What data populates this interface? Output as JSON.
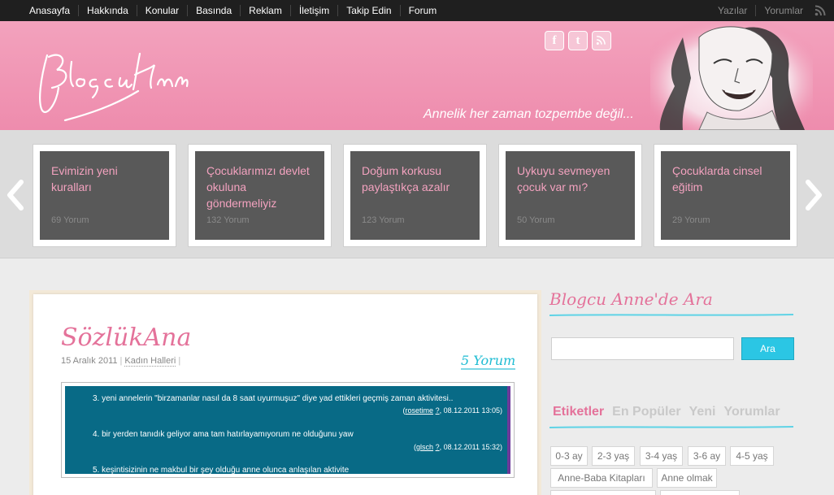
{
  "topnav": {
    "left": [
      "Anasayfa",
      "Hakkında",
      "Konular",
      "Basında",
      "Reklam",
      "İletişim",
      "Takip Edin",
      "Forum"
    ],
    "right": [
      "Yazılar",
      "Yorumlar"
    ]
  },
  "header": {
    "tagline": "Annelik her zaman tozpembe değil...",
    "social": {
      "facebook": "f",
      "twitter": "t"
    }
  },
  "slider": {
    "cards": [
      {
        "title": "Evimizin yeni kuralları",
        "count": "69 Yorum"
      },
      {
        "title": "Çocuklarımızı devlet okuluna göndermeliyiz",
        "count": "132 Yorum"
      },
      {
        "title": "Doğum korkusu paylaştıkça azalır",
        "count": "123 Yorum"
      },
      {
        "title": "Uykuyu sevmeyen çocuk var mı?",
        "count": "50 Yorum"
      },
      {
        "title": "Çocuklarda cinsel eğitim",
        "count": "29 Yorum"
      }
    ]
  },
  "post": {
    "title": "SözlükAna",
    "date": "15 Aralık 2011",
    "category": "Kadın Halleri",
    "comments": "5 Yorum",
    "entries": [
      {
        "text": "3.  yeni annelerin \"birzamanlar nasıl da 8 saat uyurmuşuz\" diye yad ettikleri geçmiş zaman aktivitesi..",
        "user": "rosetime",
        "q": "?",
        "date": ", 08.12.2011 13:05)"
      },
      {
        "text": "4.  bir yerden tanıdık geliyor ama tam hatırlayamıyorum ne olduğunu yaw",
        "user": "glsch",
        "q": "?",
        "date": ", 08.12.2011 15:32)"
      },
      {
        "text": "5.  keşintisizinin ne makbul bir şey olduğu anne olunca anlaşılan aktivite",
        "user": "",
        "q": "",
        "date": ""
      }
    ]
  },
  "sidebar": {
    "search_title": "Blogcu Anne'de Ara",
    "search_button": "Ara",
    "search_value": "",
    "tabs": [
      "Etiketler",
      "En Popüler",
      "Yeni",
      "Yorumlar"
    ],
    "tags": [
      "0-3 ay",
      "2-3 yaş",
      "3-4 yaş",
      "3-6 ay",
      "4-5 yaş",
      "Anne-Baba Kitapları",
      "Anne olmak"
    ]
  },
  "colors": {
    "pink": "#e4729a",
    "header_pink": "#f3a2bd",
    "cyan": "#2bc6e4",
    "card_gray": "#595959",
    "nav_bg": "#1f1f1f",
    "embed_blue": "#086a86"
  }
}
